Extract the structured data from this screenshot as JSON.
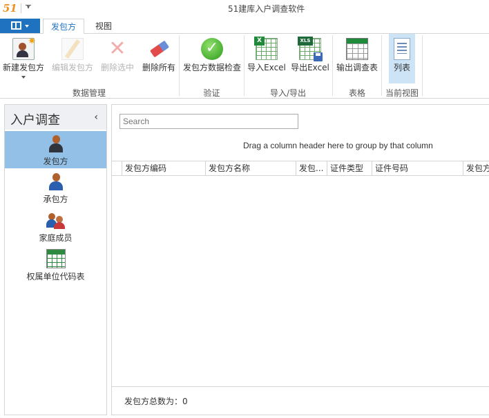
{
  "app": {
    "logo": "51",
    "title": "51建库入户调查软件"
  },
  "tabs": {
    "active": "发包方",
    "view": "视图"
  },
  "ribbon": {
    "buttons": {
      "new": "新建发包方",
      "edit": "编辑发包方",
      "delete_selected": "删除选中",
      "delete_all": "删除所有",
      "check": "发包方数据检查",
      "import_excel": "导入Excel",
      "export_excel": "导出Excel",
      "export_table": "输出调查表",
      "list": "列表"
    },
    "groups": {
      "data": "数据管理",
      "verify": "验证",
      "io": "导入/导出",
      "table": "表格",
      "view": "当前视图"
    }
  },
  "nav": {
    "title": "入户调查",
    "collapse_glyph": "‹",
    "items": [
      {
        "label": "发包方"
      },
      {
        "label": "承包方"
      },
      {
        "label": "家庭成员"
      },
      {
        "label": "权属单位代码表"
      }
    ]
  },
  "main": {
    "search_placeholder": "Search",
    "group_hint": "Drag a column header here to group by that column",
    "columns": [
      "发包方编码",
      "发包方名称",
      "发包...",
      "证件类型",
      "证件号码",
      "发包方"
    ],
    "footer_label": "发包方总数为：",
    "footer_count": "0"
  },
  "colors": {
    "accent": "#1e72c0",
    "nav_selected": "#92c0e6",
    "ribbon_selected": "#cde4f7"
  }
}
